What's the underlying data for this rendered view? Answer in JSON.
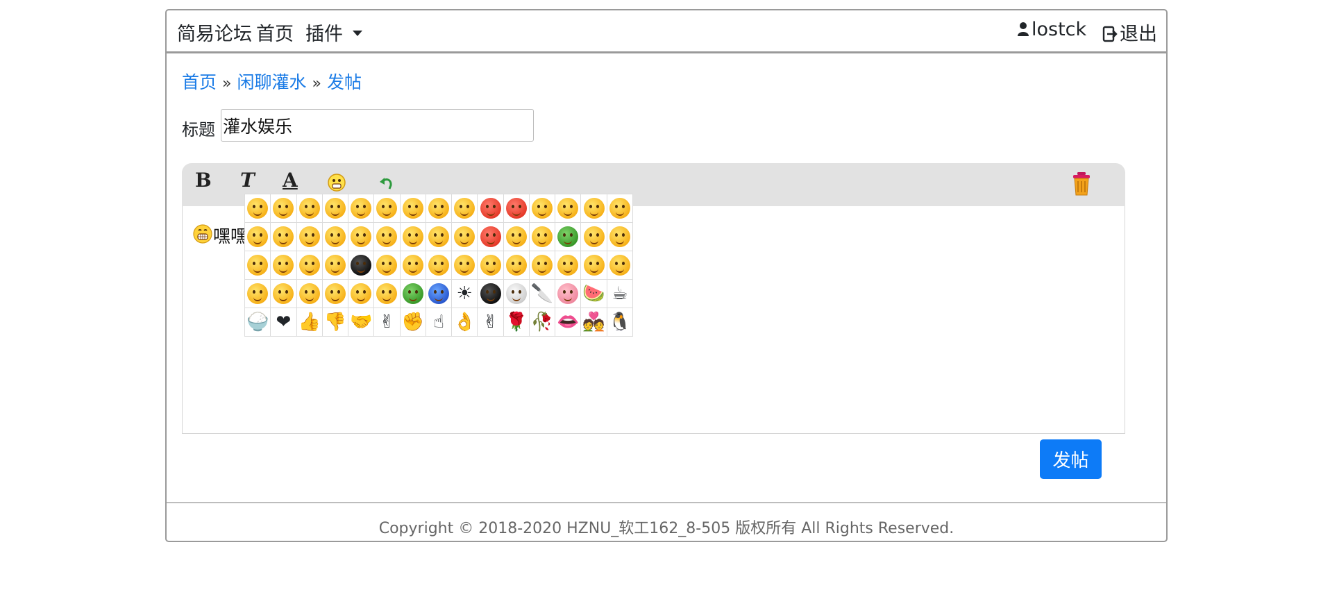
{
  "nav": {
    "brand": "简易论坛",
    "home": "首页",
    "plugins": "插件",
    "username": "lostck",
    "logout": "退出"
  },
  "breadcrumb": {
    "home": "首页",
    "separator": "»",
    "board": "闲聊灌水",
    "current": "发帖"
  },
  "form": {
    "title_label": "标题",
    "title_value": "灌水娱乐"
  },
  "editor": {
    "toolbar": {
      "bold": "B",
      "italic": "T",
      "color": "A",
      "emoji": "emoji-icon",
      "undo": "undo-icon",
      "clear": "trash-icon"
    },
    "content_text": "嘿嘿"
  },
  "emoji_panel": {
    "columns": 15,
    "rows": 5,
    "icons": [
      "smile-emoji",
      "shy-emoji",
      "love-eyes-emoji",
      "stare-emoji",
      "cry-emoji",
      "blush-emoji",
      "shutup-emoji",
      "sleepy-emoji",
      "tears-emoji",
      "angry-emoji",
      "rage-emoji",
      "smile-emoji",
      "grin-emoji",
      "surprised-emoji",
      "sad-emoji",
      "shocked-emoji",
      "laugh-emoji",
      "faint-emoji",
      "think-emoji",
      "happy-emoji",
      "amazed-emoji",
      "unhappy-emoji",
      "worried-emoji",
      "dizzy-emoji",
      "mad-emoji",
      "wink-emoji",
      "cool-emoji",
      "turtle-emoji",
      "naughty-emoji",
      "drool-emoji",
      "question-emoji",
      "nervous-emoji",
      "embarrassed-emoji",
      "blurred-emoji",
      "skull-owl-emoji",
      "hidden-emoji",
      "shy-peek-emoji",
      "wipe-sweat-emoji",
      "puzzled-emoji",
      "huh-emoji",
      "chuckle-emoji",
      "pout-emoji",
      "smug-emoji",
      "hug-emoji",
      "snicker-emoji",
      "grievance-emoji",
      "sulk-emoji",
      "sly-emoji",
      "kiss-emoji",
      "scared-emoji",
      "pitiful-emoji",
      "frog-emoji",
      "moon-emoji",
      "sun-emoji",
      "bomb-emoji",
      "skull-emoji",
      "knife-emoji",
      "pig-emoji",
      "watermelon-emoji",
      "coffee-emoji",
      "rice-emoji",
      "heart-emoji",
      "thumbs-up-emoji",
      "thumbs-down-emoji",
      "handshake-emoji",
      "victory-emoji",
      "fist-emoji",
      "point-emoji",
      "ok-emoji",
      "yeah-emoji",
      "rose-emoji",
      "wilted-rose-emoji",
      "lips-emoji",
      "couple-emoji",
      "penguin-emoji"
    ]
  },
  "actions": {
    "post": "发帖"
  },
  "footer": {
    "text": "Copyright © 2018-2020 HZNU_软工162_8-505 版权所有 All Rights Reserved."
  },
  "colors": {
    "accent": "#0d7bf7",
    "link": "#1a7be6",
    "toolbar_bg": "#e2e2e2",
    "border": "#9a9a9a"
  }
}
